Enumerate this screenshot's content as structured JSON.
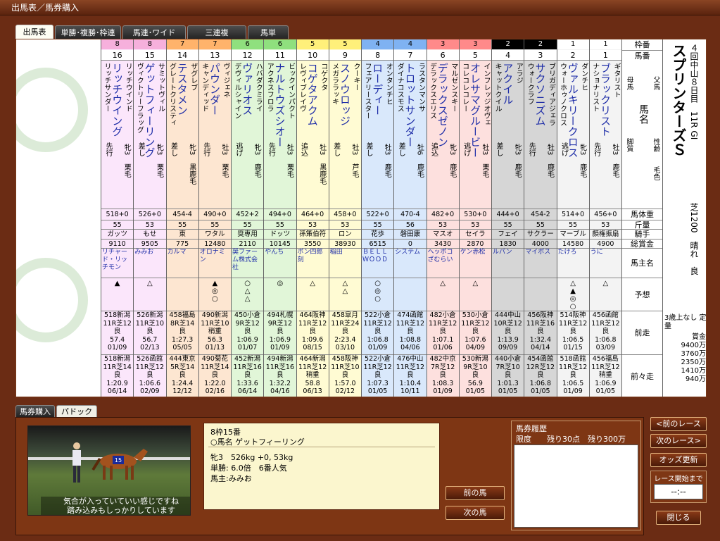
{
  "window": {
    "title": "出馬表／馬券購入"
  },
  "main_tabs": [
    {
      "label": "出馬表",
      "active": true
    },
    {
      "label": "単勝･複勝･枠連",
      "active": false
    },
    {
      "label": "馬連･ワイド",
      "active": false
    },
    {
      "label": "三連複",
      "active": false
    },
    {
      "label": "馬単",
      "active": false
    }
  ],
  "race": {
    "title": "スプリンターズＳ",
    "info": "４回中山８日目　11R GI",
    "conditions": "芝1200　晴れ　良",
    "prize_label": "3歳上なし 定量",
    "prize_head": "賞金",
    "prizes": [
      "9400万",
      "3760万",
      "2350万",
      "1410万",
      "940万"
    ]
  },
  "labels": {
    "waku": "枠番",
    "umaban": "馬番",
    "father": "父馬",
    "mother": "母馬",
    "name": "馬名",
    "style": "脚質",
    "sex_age": "性齢",
    "color": "毛色",
    "weight": "馬体重",
    "kinryo": "斤量",
    "jockey": "騎手",
    "total_prize": "総賞金",
    "owner": "馬主名",
    "yoso": "予想",
    "last": "前走",
    "before_last": "前々走"
  },
  "horses": [
    {
      "waku": "8",
      "num": "16",
      "sire": "リッチウインド",
      "name": "リッチウイング",
      "dam": "リッチサンダー",
      "sex_age": "牝3",
      "color": "栗毛",
      "style": "先行",
      "weight": "518+0",
      "kinryo": "55",
      "jockey": "ガッツ",
      "prize": "9110",
      "owner": "リチャード・リッチモン",
      "marks": "▲",
      "r1": [
        "518新潟",
        "11R芝12",
        "良",
        "57.4",
        "01/09"
      ],
      "r2": [
        "518新潟",
        "11R芝14",
        "良",
        "1:20.9",
        "06/14"
      ]
    },
    {
      "waku": "8",
      "num": "15",
      "sire": "サミットヴィル",
      "name": "ゲットフィーリング",
      "dam": "ヴィクトリーフラッグ",
      "sex_age": "牝3",
      "color": "栗毛",
      "style": "差し",
      "weight": "526+0",
      "kinryo": "53",
      "jockey": "もせ",
      "prize": "9505",
      "owner": "みみお",
      "marks": "△",
      "r1": [
        "526新潟",
        "11R芝10",
        "良",
        "56.7",
        "02/13"
      ],
      "r2": [
        "526函館",
        "11R芝12",
        "良",
        "1:06.6",
        "02/09"
      ]
    },
    {
      "waku": "7",
      "num": "14",
      "sire": "ザグレブ",
      "name": "テスタメン",
      "dam": "グレートクリスティ",
      "sex_age": "牝3",
      "color": "黒鹿毛",
      "style": "差し",
      "weight": "454-4",
      "kinryo": "55",
      "jockey": "東",
      "prize": "775",
      "owner": "カルマ",
      "marks": "",
      "r1": [
        "458福島",
        "8R芝14",
        "良",
        "1:27.3",
        "05/05"
      ],
      "r2": [
        "444東京",
        "5R芝14",
        "良",
        "1:24.4",
        "12/12"
      ]
    },
    {
      "waku": "7",
      "num": "13",
      "sire": "ヴィジェネ",
      "name": "パウンダー",
      "dam": "キャンディッド",
      "sex_age": "牡3",
      "color": "栗毛",
      "style": "先行",
      "weight": "490+0",
      "kinryo": "55",
      "jockey": "ワタル",
      "prize": "12480",
      "owner": "オロナミン",
      "marks": "▲◎○",
      "r1": [
        "490新潟",
        "11R芝10",
        "稍重",
        "56.3",
        "01/13"
      ],
      "r2": [
        "490菊花",
        "11R芝14",
        "良",
        "1:22.0",
        "02/16"
      ]
    },
    {
      "waku": "6",
      "num": "12",
      "sire": "ハバダクミライ",
      "name": "ヴァリオス",
      "dam": "デヴィルシャイン",
      "sex_age": "牝3",
      "color": "鹿毛",
      "style": "逃げ",
      "weight": "452+2",
      "kinryo": "55",
      "jockey": "奨専用",
      "prize": "2110",
      "owner": "奨ファーム株式会社",
      "marks": "○△△",
      "r1": [
        "450小倉",
        "9R芝12",
        "良",
        "1:06.9",
        "01/07"
      ],
      "r2": [
        "452新潟",
        "11R芝16",
        "良",
        "1:33.6",
        "06/14"
      ]
    },
    {
      "waku": "6",
      "num": "11",
      "sire": "ビックインパクト",
      "name": "ナルトウズシオー",
      "dam": "アクネスフロラ",
      "sex_age": "牡3",
      "color": "栗毛",
      "style": "先行",
      "weight": "494+0",
      "kinryo": "55",
      "jockey": "ドッツ",
      "prize": "10145",
      "owner": "やんち",
      "marks": "◎",
      "r1": [
        "494札幌",
        "9R芝12",
        "良",
        "1:06.9",
        "01/09"
      ],
      "r2": [
        "494新潟",
        "11R芝16",
        "良",
        "1:32.2",
        "04/16"
      ]
    },
    {
      "waku": "5",
      "num": "10",
      "sire": "コゲクタ",
      "name": "コゲタアクム",
      "dam": "レヴィブレイヴ",
      "sex_age": "牡3",
      "color": "黒鹿毛",
      "style": "追込",
      "weight": "464+0",
      "kinryo": "53",
      "jockey": "孫策伯符",
      "prize": "3550",
      "owner": "ボン四郎刻",
      "marks": "△",
      "r1": [
        "464阪神",
        "11R芝12",
        "良",
        "1:09.6",
        "08/15"
      ],
      "r2": [
        "464新潟",
        "11R芝12",
        "稍重",
        "58.8",
        "06/13"
      ]
    },
    {
      "waku": "5",
      "num": "9",
      "sire": "クーキー",
      "name": "スノウロッジ",
      "dam": "メガララッキ",
      "sex_age": "牡3",
      "color": "芦毛",
      "style": "差し",
      "weight": "458+0",
      "kinryo": "53",
      "jockey": "ロン",
      "prize": "38930",
      "owner": "稲田",
      "marks": "△△",
      "r1": [
        "458皐月",
        "11R芝24",
        "良",
        "2:23.4",
        "03/10"
      ],
      "r2": [
        "458阪神",
        "11R芝10",
        "良",
        "1:57.0",
        "02/12"
      ]
    },
    {
      "waku": "4",
      "num": "8",
      "sire": "オンタンチヒ",
      "name": "ローディー",
      "dam": "フェアリースター",
      "sex_age": "牡3",
      "color": "鹿毛",
      "style": "差し",
      "weight": "522+0",
      "kinryo": "55",
      "jockey": "花歩",
      "prize": "6515",
      "owner": "ＢＥＬＬＷＯＯＤ",
      "marks": "○◎○",
      "r1": [
        "522小倉",
        "11R芝12",
        "良",
        "1:06.8",
        "01/09"
      ],
      "r2": [
        "522小倉",
        "11R芝12",
        "良",
        "1:07.3",
        "01/05"
      ]
    },
    {
      "waku": "4",
      "num": "7",
      "sire": "ラスタンマンサ",
      "name": "トロットサンダー",
      "dam": "ダイナコスモス",
      "sex_age": "牡6",
      "color": "鹿毛",
      "style": "差し",
      "weight": "470-4",
      "kinryo": "56",
      "jockey": "磐田康",
      "prize": "0",
      "owner": "システム",
      "marks": "",
      "r1": [
        "474函館",
        "11R芝12",
        "良",
        "1:08.8",
        "04/06"
      ],
      "r2": [
        "476中山",
        "11R芝12",
        "良",
        "1:10.4",
        "10/11"
      ]
    },
    {
      "waku": "3",
      "num": "6",
      "sire": "マルゼンスキー",
      "name": "デラックスゼノン",
      "dam": "デラックスエリス",
      "sex_age": "牝3",
      "color": "鹿毛",
      "style": "追込",
      "weight": "482+0",
      "kinryo": "53",
      "jockey": "マスオ",
      "prize": "3430",
      "owner": "ヘッポコざむらい",
      "marks": "△",
      "r1": [
        "482小倉",
        "11R芝12",
        "良",
        "1:07.1",
        "01/06"
      ],
      "r2": [
        "482中京",
        "7R芝12",
        "良",
        "1:08.3",
        "01/09"
      ]
    },
    {
      "waku": "3",
      "num": "5",
      "sire": "インフレッジオヴェ",
      "name": "オレサマグルービー",
      "dam": "コレコレコレー",
      "sex_age": "牡3",
      "color": "栗毛",
      "style": "逃げ",
      "weight": "530+0",
      "kinryo": "53",
      "jockey": "セイラ",
      "prize": "2870",
      "owner": "ケン赤松",
      "marks": "△",
      "r1": [
        "530小倉",
        "11R芝12",
        "良",
        "1:07.6",
        "04/09"
      ],
      "r2": [
        "530新潟",
        "9R芝10",
        "良",
        "56.9",
        "01/05"
      ]
    },
    {
      "waku": "2",
      "num": "4",
      "sire": "アラジ",
      "name": "アクイル",
      "dam": "キャットクイル",
      "sex_age": "牝3",
      "color": "鹿毛",
      "style": "差し",
      "weight": "444+0",
      "kinryo": "55",
      "jockey": "フェイ",
      "prize": "1830",
      "owner": "ルパン",
      "marks": "",
      "r1": [
        "444中山",
        "10R芝12",
        "良",
        "1:13.9",
        "09/09"
      ],
      "r2": [
        "440小倉",
        "7R芝10",
        "良",
        "1:01.3",
        "01/05"
      ]
    },
    {
      "waku": "2",
      "num": "3",
      "sire": "ブリガディアジェラ",
      "name": "サクソニズム",
      "dam": "ウォークラフ",
      "sex_age": "牡3",
      "color": "鹿毛",
      "style": "先行",
      "weight": "454-2",
      "kinryo": "55",
      "jockey": "サクラー",
      "prize": "4000",
      "owner": "マイボス",
      "marks": "",
      "r1": [
        "456阪神",
        "11R芝16",
        "良",
        "1:32.4",
        "04/14"
      ],
      "r2": [
        "454函館",
        "12R芝12",
        "良",
        "1:06.8",
        "01/05"
      ]
    },
    {
      "waku": "1",
      "num": "2",
      "sire": "ダンチヒ",
      "name": "ヴァルキリークロス",
      "dam": "ウォーホゥノクロス",
      "sex_age": "牝3",
      "color": "鹿毛",
      "style": "逃げ",
      "weight": "514+0",
      "kinryo": "55",
      "jockey": "マーブル",
      "prize": "14580",
      "owner": "たけろ",
      "marks": "△▲◎○",
      "r1": [
        "514阪神",
        "11R芝12",
        "良",
        "1:06.5",
        "01/15"
      ],
      "r2": [
        "518函館",
        "11R芝12",
        "良",
        "1:06.5",
        "01/09"
      ]
    },
    {
      "waku": "1",
      "num": "1",
      "sire": "ギタリスト",
      "name": "ブラックリスト",
      "dam": "ナショナリスト",
      "sex_age": "牡3",
      "color": "鹿毛",
      "style": "先行",
      "weight": "456+0",
      "kinryo": "53",
      "jockey": "顔権振扇",
      "prize": "4900",
      "owner": "うに",
      "marks": "△",
      "r1": [
        "456函館",
        "11R芝12",
        "良",
        "1:06.8",
        "03/09"
      ],
      "r2": [
        "456福島",
        "11R芝12",
        "稍重",
        "1:06.9",
        "01/05"
      ]
    }
  ],
  "waku_colors": {
    "8": "#f6b0dc",
    "7": "#ffb36b",
    "6": "#8fe07e",
    "5": "#fff07a",
    "4": "#7fb2f2",
    "3": "#ff8a8a",
    "2": "#000000",
    "1": "#ffffff"
  },
  "waku_bg": {
    "8": "#fbe6fb",
    "7": "#fde6d1",
    "6": "#e1f6d8",
    "5": "#fffbd3",
    "4": "#d9e8fb",
    "3": "#fde0de",
    "2": "#d6d6d6",
    "1": "#f3f3f3"
  },
  "bottom_tabs": [
    {
      "label": "馬券購入",
      "active": false
    },
    {
      "label": "パドック",
      "active": true
    }
  ],
  "paddock": {
    "message1": "気合が入っていていい感じですね",
    "message2": "踏み込みもしっかりしています",
    "saddle_number": "15"
  },
  "selected": {
    "line1": "8枠15番",
    "line2": "○馬名 ゲットフィーリング",
    "line3": "牝3　526kg +0, 53kg",
    "line4": "単勝: 6.0倍　6番人気",
    "line5": "馬主:みみお"
  },
  "buttons": {
    "prev_horse": "前の馬",
    "next_horse": "次の馬",
    "prev_race": "<前のレース",
    "next_race": "次のレース>",
    "odds": "オッズ更新",
    "close": "閉じる"
  },
  "history": {
    "title": "馬券履歴",
    "limit": "限度　　残り30点　残り300万"
  },
  "timer": {
    "label": "レース開始まで",
    "value": "--:--"
  }
}
